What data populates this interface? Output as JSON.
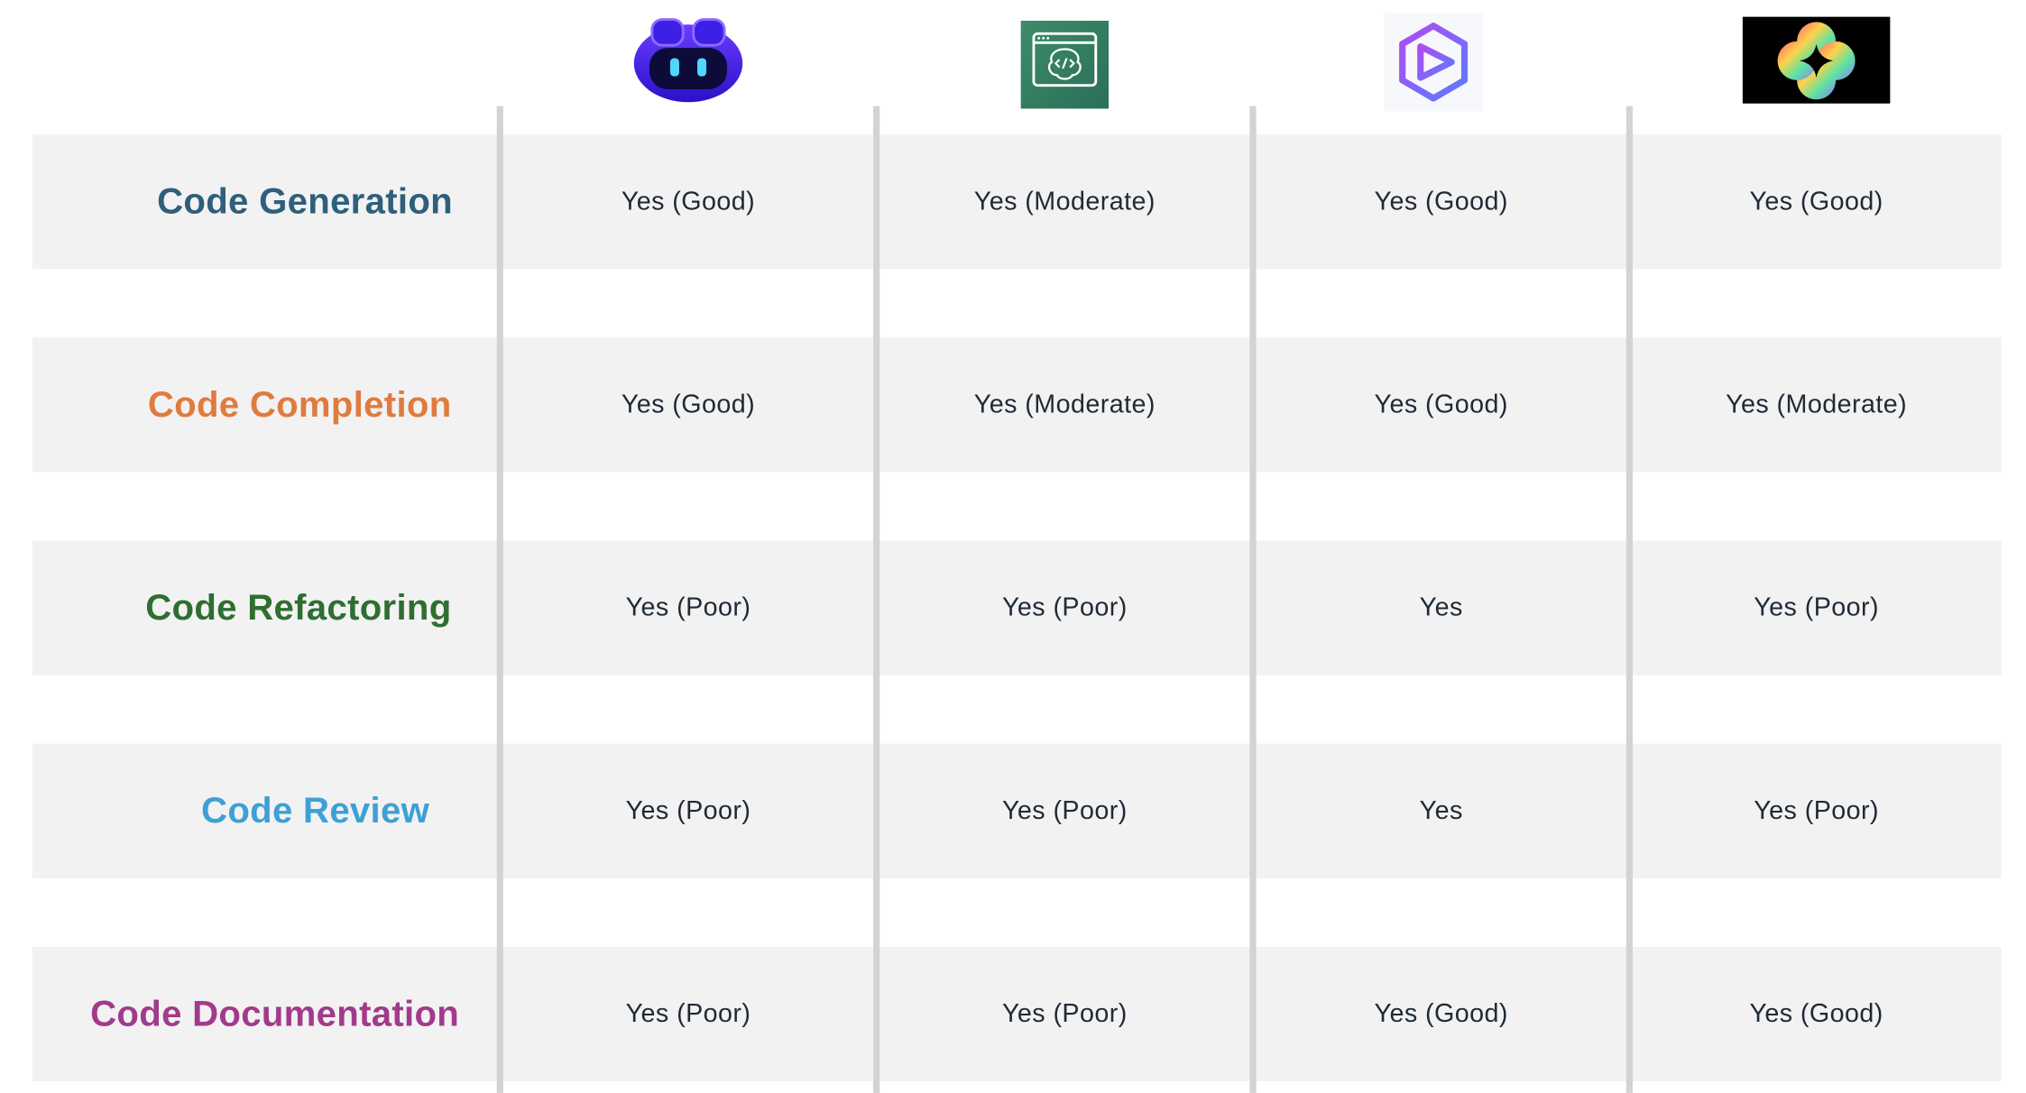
{
  "tools": [
    {
      "icon": "copilot-robot-icon"
    },
    {
      "icon": "code-window-brain-icon"
    },
    {
      "icon": "hexagon-play-icon"
    },
    {
      "icon": "gradient-sparkle-icon"
    }
  ],
  "rows": [
    {
      "label": "Code Generation",
      "color": "#2e5f7b",
      "values": [
        "Yes (Good)",
        "Yes (Moderate)",
        "Yes (Good)",
        "Yes (Good)"
      ]
    },
    {
      "label": "Code Completion",
      "color": "#e07b3f",
      "values": [
        "Yes (Good)",
        "Yes (Moderate)",
        "Yes (Good)",
        "Yes (Moderate)"
      ]
    },
    {
      "label": "Code Refactoring",
      "color": "#2f6e31",
      "values": [
        "Yes (Poor)",
        "Yes (Poor)",
        "Yes",
        "Yes (Poor)"
      ]
    },
    {
      "label": "Code Review",
      "color": "#3ea0d4",
      "values": [
        "Yes (Poor)",
        "Yes (Poor)",
        "Yes",
        "Yes (Poor)"
      ]
    },
    {
      "label": "Code Documentation",
      "color": "#a23a8c",
      "values": [
        "Yes (Poor)",
        "Yes (Poor)",
        "Yes (Good)",
        "Yes (Good)"
      ]
    }
  ]
}
